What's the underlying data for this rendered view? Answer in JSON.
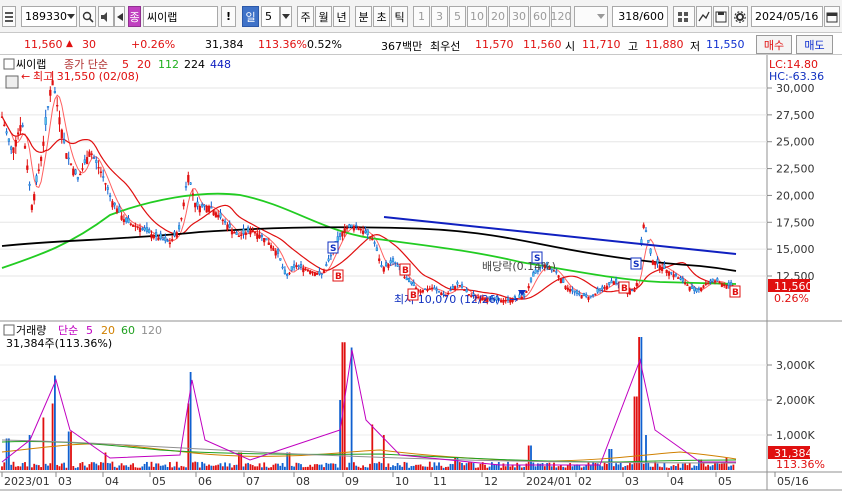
{
  "toolbar": {
    "code": "189330",
    "badge": "종",
    "name": "씨이랩",
    "exclaim": "!",
    "period_unit": "일",
    "period_num": "5",
    "tabs": [
      "주",
      "월",
      "년",
      "분",
      "초",
      "틱"
    ],
    "nums": [
      "1",
      "3",
      "5",
      "10",
      "20",
      "30",
      "60",
      "120"
    ],
    "count": "318/600",
    "date": "2024/05/16"
  },
  "quote": {
    "price": "11,560",
    "arrow": "▲",
    "change": "30",
    "pct": "+0.26%",
    "volume": "31,384",
    "vol_ratio": "113.36%",
    "turnover": "0.52%",
    "amount": "367백만",
    "best_label": "최우선",
    "best_ask": "11,570",
    "best_bid": "11,560",
    "open_label": "시",
    "open": "11,710",
    "high_label": "고",
    "high": "11,880",
    "low_label": "저",
    "low": "11,550",
    "buy": "매수",
    "sell": "매도"
  },
  "price_panel": {
    "legend_name": "씨이랩",
    "legend_ma": "종가 단순",
    "ma_periods": [
      "5",
      "20",
      "112",
      "224",
      "448"
    ],
    "ma_colors": [
      "#e01010",
      "#e01010",
      "#20c020",
      "#000000",
      "#1020c0"
    ],
    "high_note": "최고 31,550 (02/08)",
    "low_note": "최저 10,070 (12/26)",
    "dividend_note": "배당락(0.14%)",
    "lc": "LC:14.80",
    "hc": "HC:-63.36",
    "current_price": "11,560",
    "current_pct": "0.26%"
  },
  "volume_panel": {
    "legend_name": "거래량",
    "legend_ma": "단순",
    "ma_periods": [
      "5",
      "20",
      "60",
      "120"
    ],
    "ma_colors": [
      "#c000c0",
      "#d08000",
      "#20a020",
      "#909090"
    ],
    "value_text": "31,384주(113.36%)",
    "current_volume": "31,384",
    "current_pct": "113.36%"
  },
  "x_axis_labels": [
    "2023/01",
    "03",
    "04",
    "05",
    "06",
    "07",
    "08",
    "09",
    "10",
    "11",
    "12",
    "2024/01",
    "02",
    "03",
    "04",
    "05",
    "05/16"
  ],
  "chart_data": {
    "type": "candlestick",
    "price_axis_ticks": [
      12500,
      15000,
      17500,
      20000,
      22500,
      25000,
      27500,
      30000
    ],
    "price_axis_labels": [
      "12,500",
      "15,000",
      "17,500",
      "20,000",
      "22,500",
      "25,000",
      "27,500",
      "30,000"
    ],
    "volume_axis_ticks": [
      1000000,
      2000000,
      3000000
    ],
    "volume_axis_labels": [
      "1,000K",
      "2,000K",
      "3,000K"
    ],
    "period_high": 31550,
    "period_low": 10070,
    "last_close": 11560,
    "last_volume": 31384
  }
}
